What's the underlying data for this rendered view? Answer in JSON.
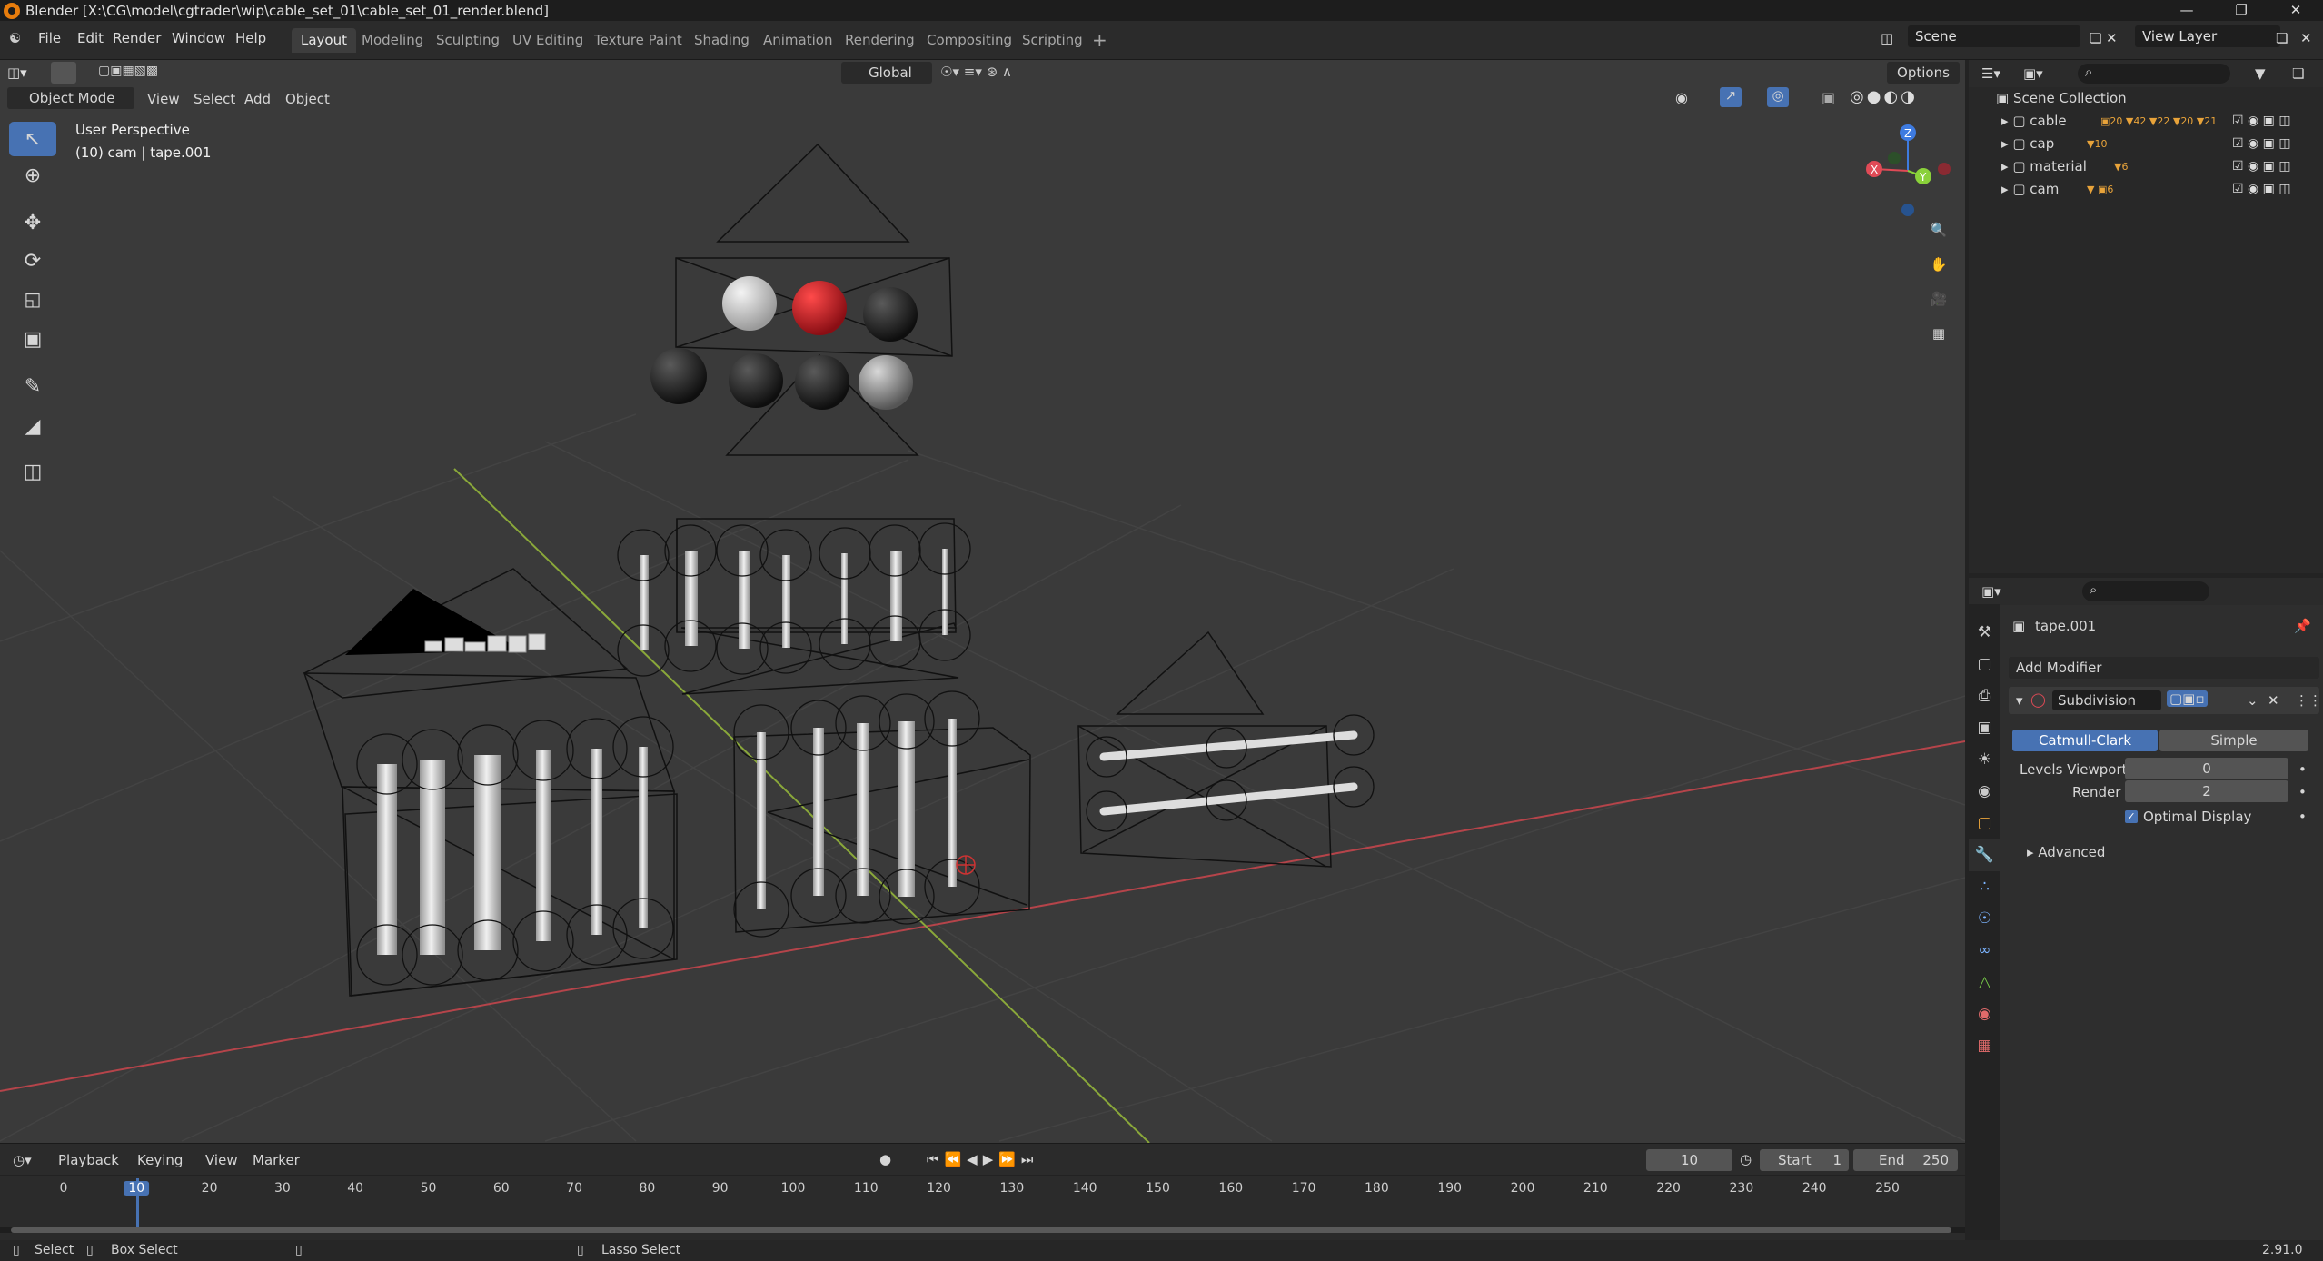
{
  "title": "Blender [X:\\CG\\model\\cgtrader\\wip\\cable_set_01\\cable_set_01_render.blend]",
  "menu": [
    "File",
    "Edit",
    "Render",
    "Window",
    "Help"
  ],
  "workspaces": [
    "Layout",
    "Modeling",
    "Sculpting",
    "UV Editing",
    "Texture Paint",
    "Shading",
    "Animation",
    "Rendering",
    "Compositing",
    "Scripting"
  ],
  "scene": "Scene",
  "view_layer": "View Layer",
  "header": {
    "transform": "Global",
    "options": "Options",
    "mode": "Object Mode",
    "view": "View",
    "select": "Select",
    "add": "Add",
    "object": "Object"
  },
  "viewport": {
    "perspective": "User Perspective",
    "info": "(10) cam | tape.001"
  },
  "outliner": {
    "root": "Scene Collection",
    "items": [
      {
        "name": "cable",
        "badges": [
          "20",
          "42",
          "22",
          "20",
          "21"
        ]
      },
      {
        "name": "cap",
        "badges": [
          "10"
        ]
      },
      {
        "name": "material",
        "badges": [
          "6"
        ]
      },
      {
        "name": "cam",
        "badges": [
          "6"
        ]
      }
    ]
  },
  "properties": {
    "object": "tape.001",
    "add_modifier": "Add Modifier",
    "modifier": "Subdivision",
    "mode_a": "Catmull-Clark",
    "mode_b": "Simple",
    "levels_label": "Levels Viewport",
    "levels_value": "0",
    "render_label": "Render",
    "render_value": "2",
    "optimal": "Optimal Display",
    "advanced": "Advanced"
  },
  "timeline": {
    "menus": [
      "Playback",
      "Keying",
      "View",
      "Marker"
    ],
    "current": "10",
    "start_label": "Start",
    "start": "1",
    "end_label": "End",
    "end": "250",
    "ticks": [
      "0",
      "10",
      "20",
      "30",
      "40",
      "50",
      "60",
      "70",
      "80",
      "90",
      "100",
      "110",
      "120",
      "130",
      "140",
      "150",
      "160",
      "170",
      "180",
      "190",
      "200",
      "210",
      "220",
      "230",
      "240",
      "250"
    ]
  },
  "status": {
    "select": "Select",
    "box": "Box Select",
    "lasso": "Lasso Select",
    "version": "2.91.0"
  },
  "colors": {
    "accent": "#4772b3",
    "xaxis": "#b5444a",
    "yaxis": "#8aa83a",
    "red_ball": "#c0121c"
  }
}
